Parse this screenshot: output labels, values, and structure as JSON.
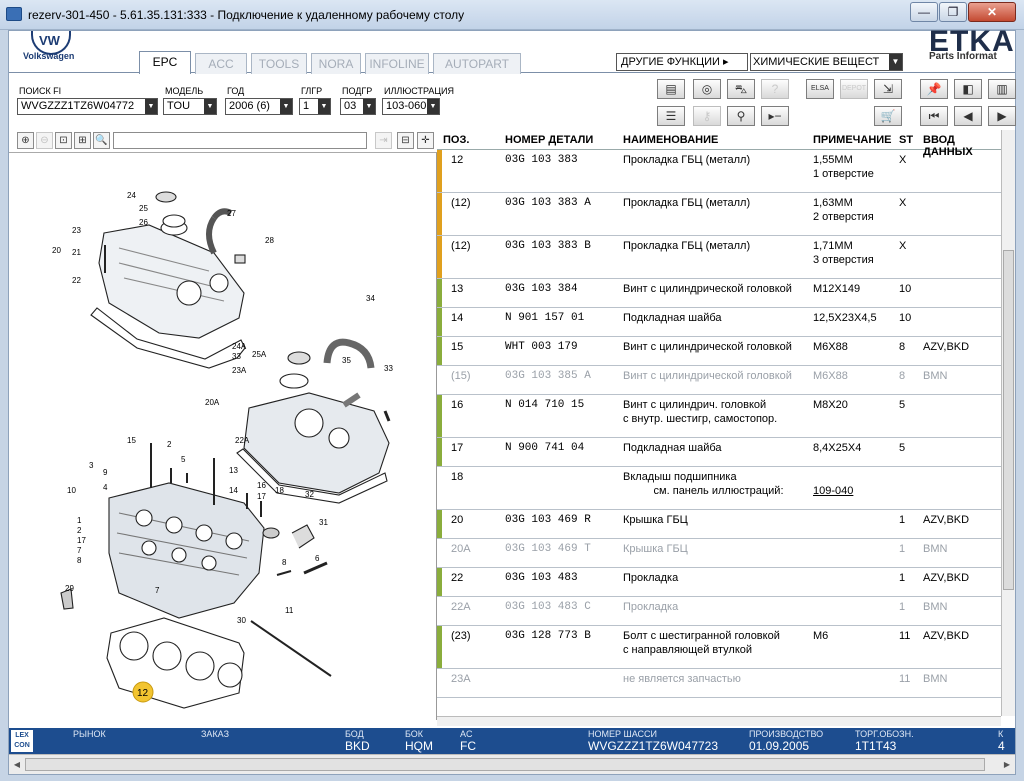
{
  "window": {
    "title": "rezerv-301-450 - 5.61.35.131:333 - Подключение к удаленному рабочему столу",
    "min_glyph": "—",
    "max_glyph": "❐",
    "close_glyph": "✕"
  },
  "header": {
    "brand_name": "Volkswagen",
    "brand_logo_letters": "VW",
    "etka_logo": "ETKA",
    "etka_sub": "Parts Informat",
    "tabs": [
      {
        "label": "EPC"
      },
      {
        "label": "ACC"
      },
      {
        "label": "TOOLS"
      },
      {
        "label": "NORA"
      },
      {
        "label": "INFOLINE"
      },
      {
        "label": "AUTOPART"
      }
    ],
    "other_functions": "ДРУГИЕ ФУНКЦИИ ▸",
    "chemicals_select": "ХИМИЧЕСКИЕ ВЕЩЕСТ"
  },
  "filters": {
    "search_fi_label": "ПОИСК FI",
    "search_fi_value": "WVGZZZ1TZ6W04772",
    "model_label": "МОДЕЛЬ",
    "model_value": "TOU",
    "year_label": "ГОД",
    "year_value": "2006 (6)",
    "main_group_label": "ГЛГР",
    "main_group_value": "1",
    "sub_group_label": "ПОДГР",
    "sub_group_value": "03",
    "illustration_label": "ИЛЛЮСТРАЦИЯ",
    "illustration_value": "103-060"
  },
  "toolbar_icons": {
    "row1": [
      "printer-icon",
      "disc-icon",
      "car-search-icon",
      "unknown-part-icon",
      "elsa-icon",
      "depot-icon",
      "cart-arrow-icon",
      "pin-icon",
      "prev-page-icon",
      "page-icon"
    ],
    "row2": [
      "list-icon",
      "key-icon",
      "bicycle-icon",
      "play-dash-icon",
      "cart-icon",
      "first-icon",
      "prev-icon",
      "next-icon"
    ]
  },
  "table": {
    "headers": {
      "pos": "ПОЗ.",
      "part_no": "НОМЕР ДЕТАЛИ",
      "name": "НАИМЕНОВАНИЕ",
      "note": "ПРИМЕЧАНИЕ",
      "st": "ST",
      "input": "ВВОД ДАННЫХ"
    },
    "rows": [
      {
        "pos": "12",
        "part": "03G  103  383",
        "name": "Прокладка ГБЦ (металл)",
        "name2": "",
        "note": "1,55MM",
        "note2": "1 отверстие",
        "st": "X",
        "input": "",
        "bar": "#e0a01e",
        "grey": false
      },
      {
        "pos": "(12)",
        "part": "03G  103  383  A",
        "name": "Прокладка ГБЦ (металл)",
        "name2": "",
        "note": "1,63MM",
        "note2": "2 отверстия",
        "st": "X",
        "input": "",
        "bar": "#e0a01e",
        "grey": false
      },
      {
        "pos": "(12)",
        "part": "03G  103  383  B",
        "name": "Прокладка ГБЦ (металл)",
        "name2": "",
        "note": "1,71MM",
        "note2": "3 отверстия",
        "st": "X",
        "input": "",
        "bar": "#e0a01e",
        "grey": false
      },
      {
        "pos": "13",
        "part": "03G  103  384",
        "name": "Винт с цилиндрической головкой",
        "name2": "",
        "note": "M12X149",
        "note2": "",
        "st": "10",
        "input": "",
        "bar": "#8aad3c",
        "grey": false
      },
      {
        "pos": "14",
        "part": "N    901  157  01",
        "name": "Подкладная шайба",
        "name2": "",
        "note": "12,5X23X4,5",
        "note2": "",
        "st": "10",
        "input": "",
        "bar": "#8aad3c",
        "grey": false
      },
      {
        "pos": "15",
        "part": "WHT  003  179",
        "name": "Винт с цилиндрической головкой",
        "name2": "",
        "note": "M6X88",
        "note2": "",
        "st": "8",
        "input": "AZV,BKD",
        "bar": "#8aad3c",
        "grey": false
      },
      {
        "pos": "(15)",
        "part": "03G  103  385  A",
        "name": "Винт с цилиндрической головкой",
        "name2": "",
        "note": "M6X88",
        "note2": "",
        "st": "8",
        "input": "BMN",
        "bar": "",
        "grey": true
      },
      {
        "pos": "16",
        "part": "N    014  710  15",
        "name": "Винт с цилиндрич. головкой",
        "name2": "с внутр. шестигр, самостопор.",
        "note": "M8X20",
        "note2": "",
        "st": "5",
        "input": "",
        "bar": "#8aad3c",
        "grey": false
      },
      {
        "pos": "17",
        "part": "N    900  741  04",
        "name": "Подкладная шайба",
        "name2": "",
        "note": "8,4X25X4",
        "note2": "",
        "st": "5",
        "input": "",
        "bar": "#8aad3c",
        "grey": false
      },
      {
        "pos": "18",
        "part": "",
        "name": "Вкладыш подшипника",
        "name2": "          см. панель иллюстраций:",
        "note": "",
        "note2": "109-040",
        "st": "",
        "input": "",
        "bar": "",
        "grey": false
      },
      {
        "pos": "20",
        "part": "03G  103  469  R",
        "name": "Крышка ГБЦ",
        "name2": "",
        "note": "",
        "note2": "",
        "st": "1",
        "input": "AZV,BKD",
        "bar": "#8aad3c",
        "grey": false
      },
      {
        "pos": "20A",
        "part": "03G  103  469  T",
        "name": "Крышка ГБЦ",
        "name2": "",
        "note": "",
        "note2": "",
        "st": "1",
        "input": "BMN",
        "bar": "",
        "grey": true
      },
      {
        "pos": "22",
        "part": "03G  103  483",
        "name": "Прокладка",
        "name2": "",
        "note": "",
        "note2": "",
        "st": "1",
        "input": "AZV,BKD",
        "bar": "#8aad3c",
        "grey": false
      },
      {
        "pos": "22A",
        "part": "03G  103  483  C",
        "name": "Прокладка",
        "name2": "",
        "note": "",
        "note2": "",
        "st": "1",
        "input": "BMN",
        "bar": "",
        "grey": true
      },
      {
        "pos": "(23)",
        "part": "03G  128  773  B",
        "name": "Болт с шестигранной головкой",
        "name2": "с направляющей втулкой",
        "note": "M6",
        "note2": "",
        "st": "11",
        "input": "AZV,BKD",
        "bar": "#8aad3c",
        "grey": false
      },
      {
        "pos": "23A",
        "part": "",
        "name": "не является запчастью",
        "name2": "",
        "note": "",
        "note2": "",
        "st": "11",
        "input": "BMN",
        "bar": "",
        "grey": true
      }
    ]
  },
  "illustration": {
    "labels": [
      "24",
      "25",
      "26",
      "27",
      "28",
      "23",
      "21",
      "20",
      "22",
      "34",
      "24A",
      "33",
      "25A",
      "23A",
      "35",
      "33",
      "20A",
      "22A",
      "15",
      "2",
      "5",
      "3",
      "9",
      "4",
      "10",
      "1",
      "2",
      "17",
      "7",
      "8",
      "14",
      "13",
      "16",
      "17",
      "18",
      "32",
      "31",
      "6",
      "8",
      "29",
      "7",
      "30",
      "11",
      "12"
    ],
    "highlight": "12"
  },
  "status": {
    "lexcon": "LEX CON",
    "market_label": "РЫНОК",
    "order_label": "ЗАКАЗ",
    "bod_label": "БОД",
    "bod_value": "BKD",
    "bok_label": "БОК",
    "bok_value": "HQM",
    "ac_label": "AC",
    "ac_value": "FC",
    "chassis_label": "НОМЕР ШАССИ",
    "chassis_value": "WVGZZZ1TZ6W047723",
    "prod_label": "ПРОИЗВОДСТВО",
    "prod_value": "01.09.2005",
    "trade_label": "ТОРГ.ОБОЗН.",
    "trade_value": "1T1T43",
    "k_label": "К",
    "k_value": "4"
  }
}
